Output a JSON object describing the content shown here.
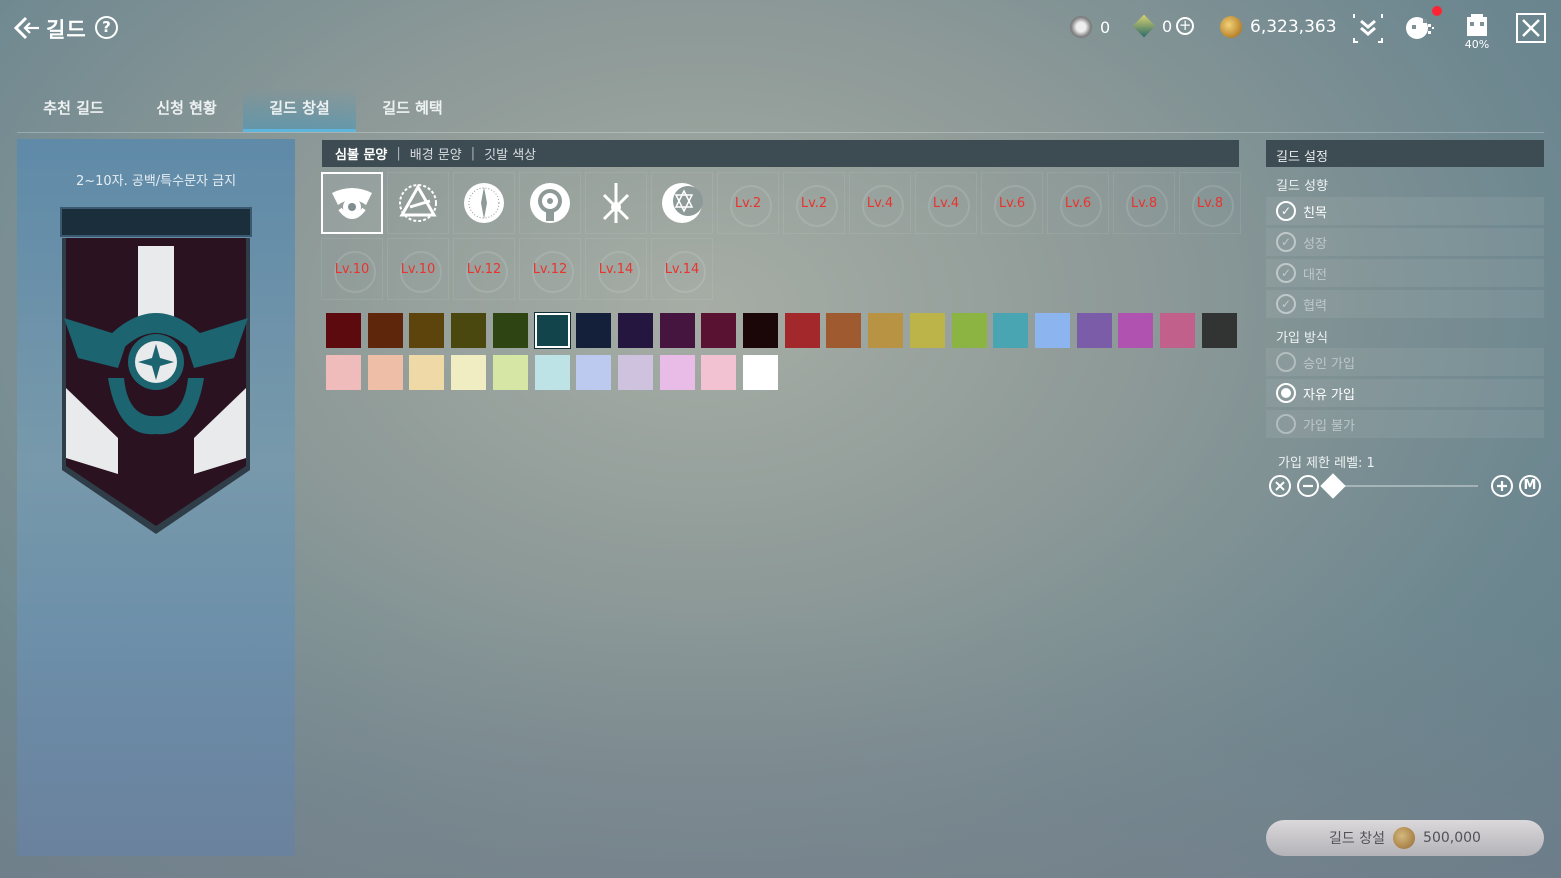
{
  "header": {
    "title": "길드",
    "help": "?",
    "currency1": "0",
    "currency2": "0",
    "gold": "6,323,363",
    "inventory_pct": "40%"
  },
  "tabs": [
    {
      "label": "추천 길드"
    },
    {
      "label": "신청 현황"
    },
    {
      "label": "길드 창설",
      "active": true
    },
    {
      "label": "길드 혜택"
    }
  ],
  "left_panel": {
    "name_rule": "2~10자. 공백/특수문자 금지",
    "name_value": ""
  },
  "subtabs": [
    "심볼 문양",
    "배경 문양",
    "깃발 색상"
  ],
  "symbols": {
    "unlocked": [
      "emblem-wings-icon",
      "emblem-triangle-icon",
      "emblem-compass-icon",
      "emblem-ring-icon",
      "emblem-swords-icon",
      "emblem-star-moon-icon"
    ],
    "row1_locked": [
      "Lv.2",
      "Lv.2",
      "Lv.4",
      "Lv.4",
      "Lv.6",
      "Lv.6",
      "Lv.8",
      "Lv.8"
    ],
    "row2_locked": [
      "Lv.10",
      "Lv.10",
      "Lv.12",
      "Lv.12",
      "Lv.14",
      "Lv.14"
    ]
  },
  "colors": {
    "row1": [
      "#5c0a0e",
      "#5e260b",
      "#5d440d",
      "#4a470f",
      "#2f4413",
      "#11444b",
      "#141f3a",
      "#25163f",
      "#45143f",
      "#5a1232",
      "#1c0708",
      "#a3282b",
      "#a05a30",
      "#b79343",
      "#bcb449",
      "#8cb443",
      "#4aa5b3",
      "#8cb4ef",
      "#7b5ca8",
      "#b053b0",
      "#c2608c",
      "#323434"
    ],
    "row2": [
      "#efbcbb",
      "#efbea6",
      "#eed9a7",
      "#efedc1",
      "#d6e6a5",
      "#bde3e6",
      "#bbcaee",
      "#cfc2de",
      "#e8bce6",
      "#f2c2d2",
      "#ffffff"
    ],
    "selected_index": 5
  },
  "settings": {
    "header": "길드 설정",
    "tendency_label": "길드 성향",
    "tendency_options": [
      {
        "label": "친목",
        "active": true
      },
      {
        "label": "성장",
        "active": false
      },
      {
        "label": "대전",
        "active": false
      },
      {
        "label": "협력",
        "active": false
      }
    ],
    "join_label": "가입 방식",
    "join_options": [
      {
        "label": "승인 가입",
        "selected": false
      },
      {
        "label": "자유 가입",
        "selected": true
      },
      {
        "label": "가입 불가",
        "selected": false
      }
    ],
    "level_limit_label": "가입 제한 레벨: 1",
    "level_value": 1
  },
  "create_button": {
    "label": "길드 창설",
    "cost": "500,000"
  }
}
